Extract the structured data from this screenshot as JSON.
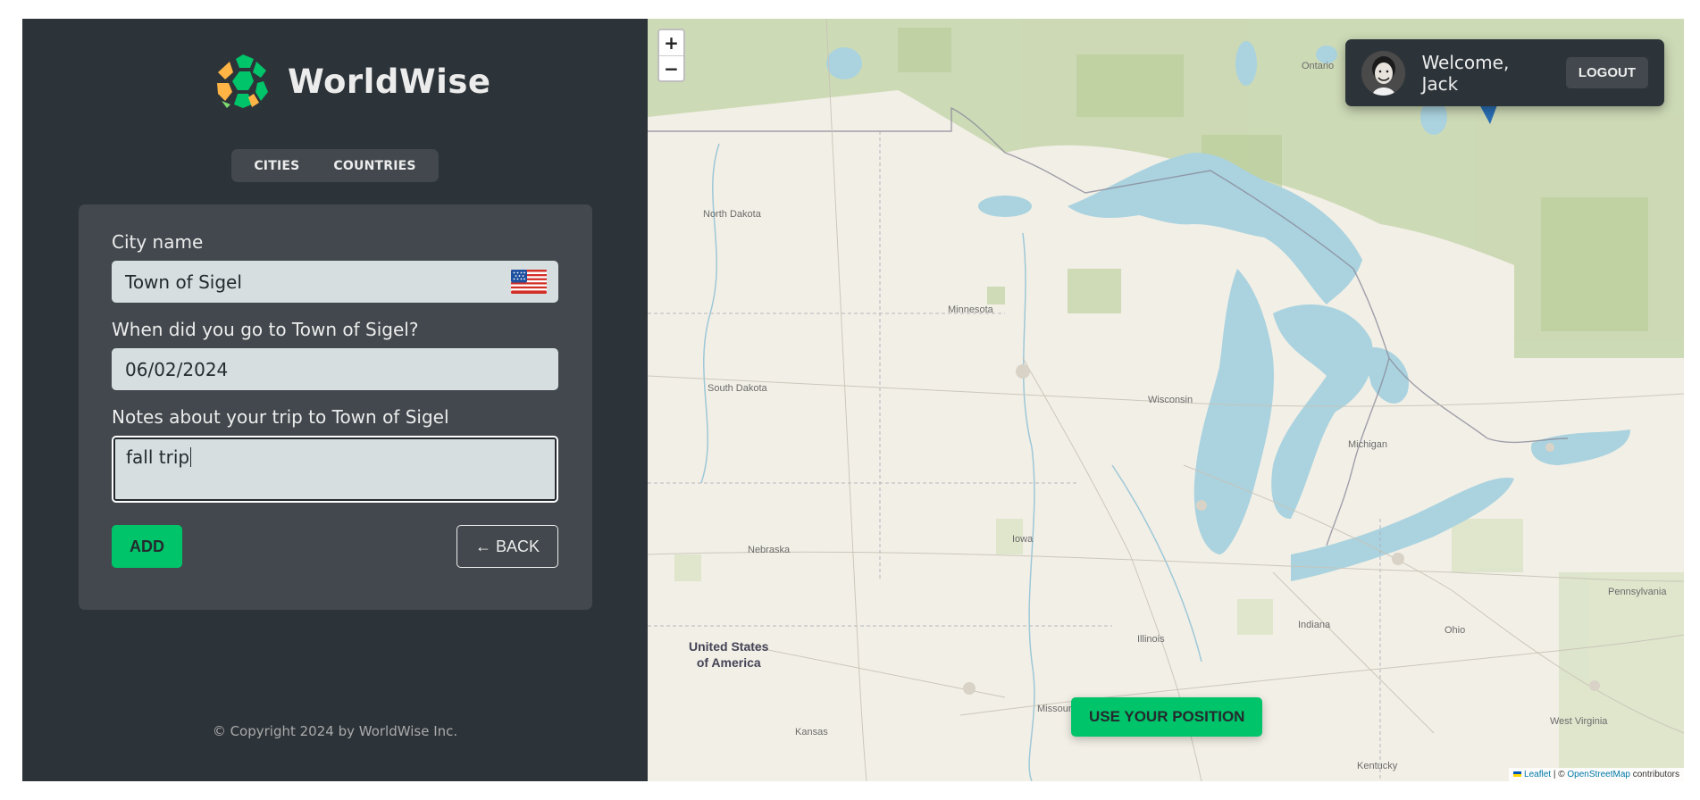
{
  "brand": {
    "name": "WorldWise"
  },
  "tabs": {
    "cities": "CITIES",
    "countries": "COUNTRIES"
  },
  "form": {
    "city_label": "City name",
    "city_value": "Town of Sigel",
    "flag_emoji": "🇺🇸",
    "date_label": "When did you go to Town of Sigel?",
    "date_value": "06/02/2024",
    "notes_label": "Notes about your trip to Town of Sigel",
    "notes_value": "fall trip",
    "add_label": "ADD",
    "back_label": "← BACK"
  },
  "footer": {
    "copyright": "© Copyright 2024 by WorldWise Inc."
  },
  "map": {
    "zoom_in": "+",
    "zoom_out": "−",
    "user": {
      "welcome": "Welcome, Jack",
      "logout": "LOGOUT"
    },
    "position_button": "USE YOUR POSITION",
    "attribution": {
      "leaflet": "Leaflet",
      "sep": " | © ",
      "osm": "OpenStreetMap",
      "suffix": " contributors"
    },
    "labels": {
      "ontario": "Ontario",
      "north_dakota": "North Dakota",
      "minnesota": "Minnesota",
      "south_dakota": "South Dakota",
      "wisconsin": "Wisconsin",
      "michigan": "Michigan",
      "nebraska": "Nebraska",
      "iowa": "Iowa",
      "illinois": "Illinois",
      "indiana": "Indiana",
      "ohio": "Ohio",
      "missouri": "Missouri",
      "kansas": "Kansas",
      "kentucky": "Kentucky",
      "west_virginia": "West Virginia",
      "pennsylvania": "Pennsylvania",
      "usa_line1": "United States",
      "usa_line2": "of America"
    }
  },
  "colors": {
    "accent_green": "#00c46a",
    "dark_bg": "#2d3439",
    "panel_bg": "#42484d",
    "input_bg": "#d6dee0",
    "water": "#aad3df"
  }
}
